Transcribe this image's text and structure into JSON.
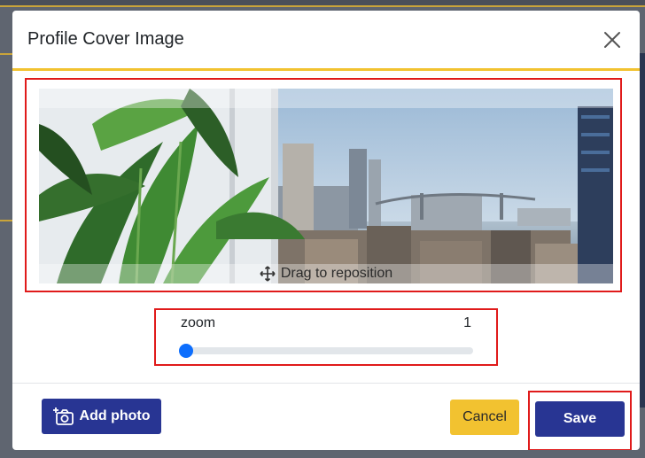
{
  "modal": {
    "title": "Profile Cover Image",
    "close_icon": "close-icon"
  },
  "cropper": {
    "hint": "Drag to reposition",
    "hint_icon": "move-icon"
  },
  "zoom": {
    "label": "zoom",
    "value": "1",
    "level": 0
  },
  "footer": {
    "add_photo_label": "Add photo",
    "add_photo_icon": "add-camera-icon",
    "cancel_label": "Cancel",
    "save_label": "Save"
  },
  "colors": {
    "primary": "#283593",
    "accent": "#f2c230",
    "slider": "#0d6efd",
    "highlight": "#e01b1b"
  }
}
